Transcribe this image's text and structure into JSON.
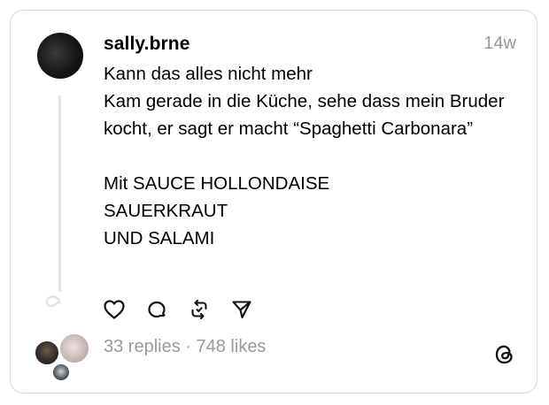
{
  "post": {
    "username": "sally.brne",
    "time": "14w",
    "text": "Kann das alles nicht mehr\nKam gerade in die Küche, sehe dass mein Bruder kocht, er sagt er macht “Spaghetti Carbonara”\n\nMit SAUCE HOLLONDAISE\nSAUERKRAUT\nUND SALAMI",
    "replies": "33 replies",
    "separator": " · ",
    "likes": "748 likes"
  },
  "icons": {
    "like": "heart-icon",
    "reply": "comment-icon",
    "repost": "repost-icon",
    "share": "send-icon",
    "brand": "threads-logo-icon"
  }
}
